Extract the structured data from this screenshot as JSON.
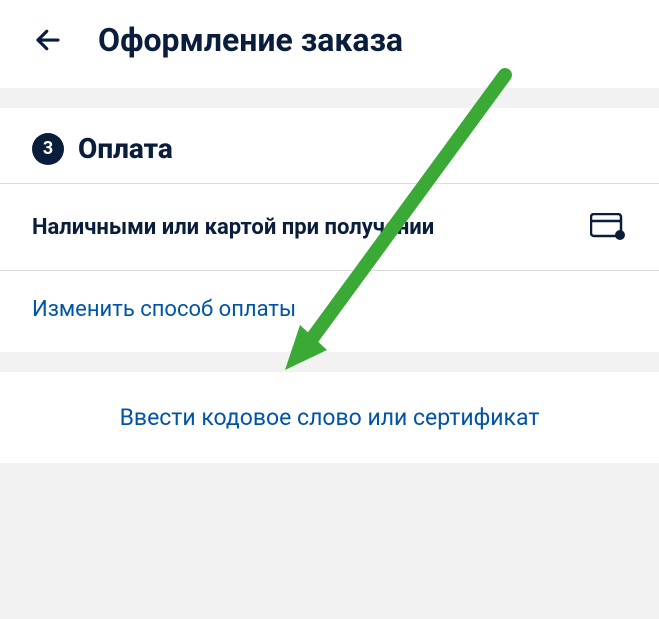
{
  "header": {
    "title": "Оформление заказа"
  },
  "payment": {
    "step_number": "3",
    "section_title": "Оплата",
    "method_label": "Наличными или картой при получении",
    "change_link": "Изменить способ оплаты"
  },
  "promo": {
    "link_text": "Ввести кодовое слово или сертификат"
  }
}
